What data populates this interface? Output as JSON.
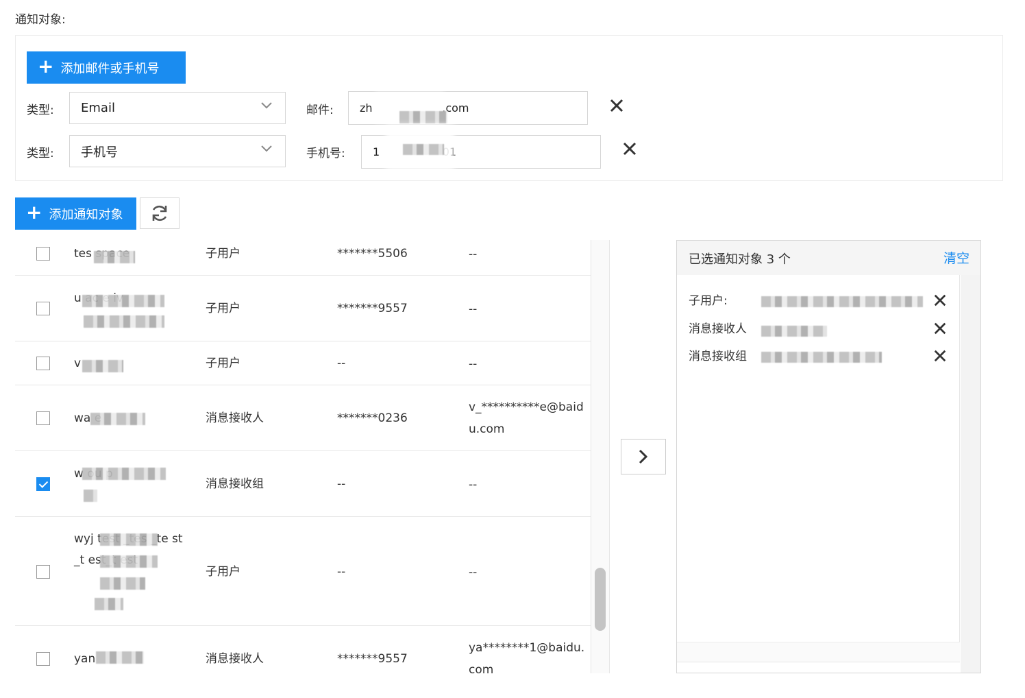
{
  "section_label": "通知对象:",
  "add_contact_button": "添加邮件或手机号",
  "contact_rows": [
    {
      "type_label": "类型:",
      "type_value": "Email",
      "value_label": "邮件:",
      "value": "zh                    .com"
    },
    {
      "type_label": "类型:",
      "type_value": "手机号",
      "value_label": "手机号:",
      "value": "1                  01"
    }
  ],
  "add_target_button": "添加通知对象",
  "table_rows": [
    {
      "name": "tes         space",
      "type": "子用户",
      "phone": "*******5506",
      "email": "--",
      "checked": false
    },
    {
      "name": "u              ac e              iv",
      "type": "子用户",
      "phone": "*******9557",
      "email": "--",
      "checked": false
    },
    {
      "name": "v",
      "type": "子用户",
      "phone": "--",
      "email": "--",
      "checked": false
    },
    {
      "name": "wa            e",
      "type": "消息接收人",
      "phone": "*******0236",
      "email": "v_**********e@baidu.com",
      "checked": false
    },
    {
      "name": "w                ou p",
      "type": "消息接收组",
      "phone": "--",
      "email": "--",
      "checked": true
    },
    {
      "name": "wyj            test _tes          _te st_t          est_t est",
      "type": "子用户",
      "phone": "--",
      "email": "--",
      "checked": false
    },
    {
      "name": "yan",
      "type": "消息接收人",
      "phone": "*******9557",
      "email": "ya********1@baidu.com",
      "checked": false
    }
  ],
  "selected_panel": {
    "title": "已选通知对象 3 个",
    "clear": "清空",
    "items": [
      {
        "label": "子用户:"
      },
      {
        "label": "消息接收人"
      },
      {
        "label": "消息接收组"
      }
    ]
  },
  "icons": {
    "add": "plus-icon",
    "refresh": "refresh-icon",
    "remove": "close-icon",
    "select": "chevron-down-icon",
    "transfer": "chevron-right-icon"
  },
  "colors": {
    "primary": "#1a8cf0",
    "border": "#d6d6d6"
  }
}
